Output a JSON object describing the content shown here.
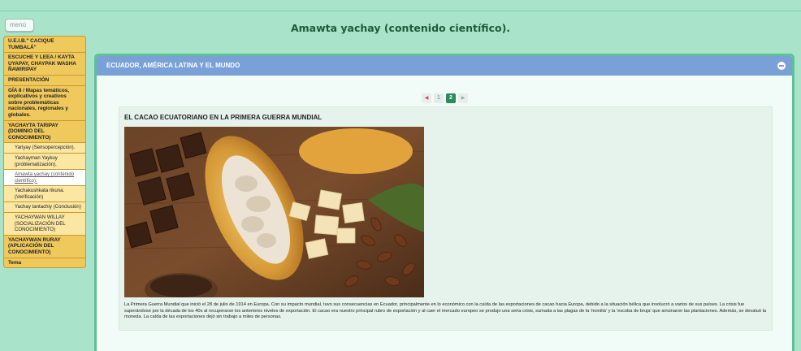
{
  "page": {
    "title": "Amawta yachay (contenido científico)."
  },
  "menu": {
    "label": "menú"
  },
  "sidebar": {
    "items": [
      {
        "label": "U.E.I.B.\" CACIQUE TUMBALÁ\""
      },
      {
        "label": "ESCUCHE Y LEEA / KAYTA UYAPAY, CHAYPAK WASHA ÑAWIRIPAY"
      },
      {
        "label": "PRESENTACIÓN"
      },
      {
        "label": "GÍA 8 / Mapas temáticos, explicativos y creativos sobre problemáticas nacionales, regionales y globales."
      },
      {
        "label": "YACHAYTA TARIPAY (DOMINIO DEL CONOCIMIENTO)"
      },
      {
        "label": "Yariyay (Sensopercepción)."
      },
      {
        "label": "Yachayman Yaykuy (problematización)."
      },
      {
        "label": "Amawta yachay (contenido científico)."
      },
      {
        "label": "Yachakushkata rikuna. (Verificación)"
      },
      {
        "label": "Yachay tantachiy (Conclusión)"
      },
      {
        "label": "YACHAYWAN WILLAY (SOCIALIZACIÓN DEL CONOCIMIENTO)"
      },
      {
        "label": "YACHAYWAN RURAY (APLICACIÓN DEL CONOCIMIENTO)"
      },
      {
        "label": "Tema"
      }
    ]
  },
  "panel": {
    "title": "ECUADOR, AMÉRICA LATINA Y EL MUNDO",
    "pager": {
      "prev": "◀",
      "pages": [
        "1",
        "2"
      ],
      "current": "2",
      "next": "▶"
    }
  },
  "article": {
    "title": "EL CACAO ECUATORIANO EN LA PRIMERA GUERRA MUNDIAL",
    "body": "La Primera Guerra Mundial que inició el 28 de julio de 1914 en Europa. Con su impacto mundial, tuvo sus consecuencias en Ecuador, principalmente en lo económico con la caída de las exportaciones de cacao hacia Europa, debido a la situación bélica que involucró a varios de sus países. La crisis fue superándose por la década de los 40s al recuperarse los anteriores niveles de exportación. El cacao era nuestro principal rubro de exportación y al caer el mercado europeo se produjo una seria crisis, sumada a las plagas de la 'monilia' y la 'escoba de bruja' que arruinaron las plantaciones. Además, se devaluó la moneda. La caída de las exportaciones dejó sin trabajo a miles de personas."
  },
  "colors": {
    "background": "#a9e3c9",
    "sidebar": "#f0c95c",
    "panel_header": "#7aa0d8",
    "pager_current": "#2c8a5e"
  }
}
